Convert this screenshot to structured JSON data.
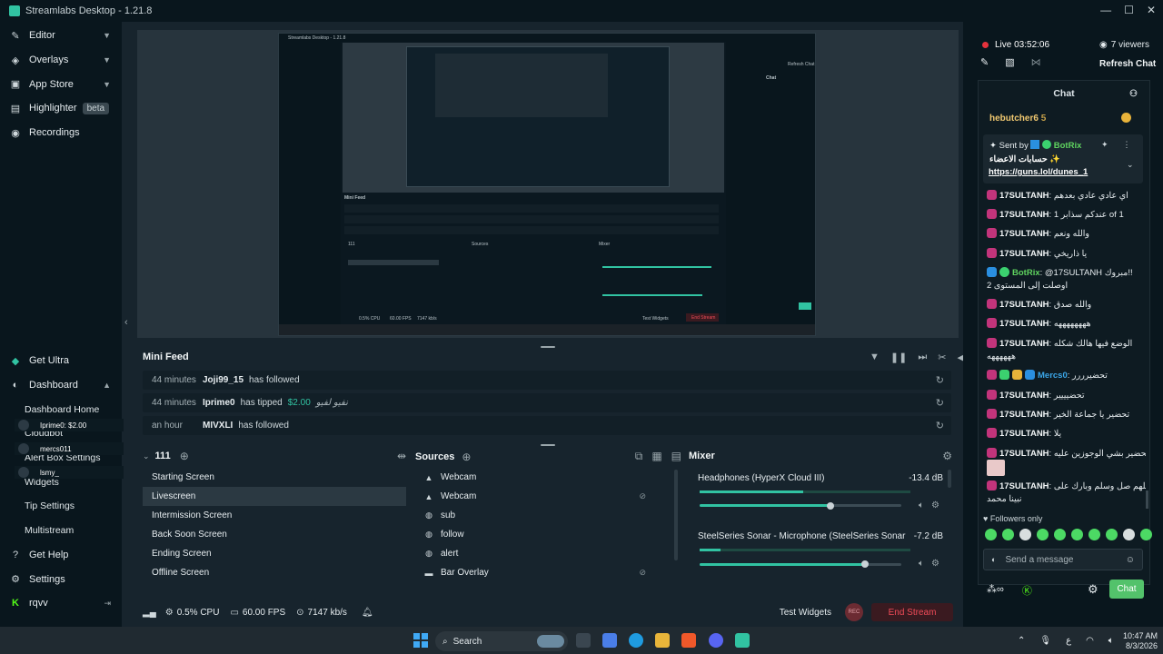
{
  "window": {
    "title": "Streamlabs Desktop - 1.21.8"
  },
  "sidebar": {
    "top": [
      {
        "label": "Editor",
        "icon": "pencil-icon"
      },
      {
        "label": "Overlays",
        "icon": "layers-icon"
      },
      {
        "label": "App Store",
        "icon": "store-icon"
      },
      {
        "label": "Highlighter",
        "icon": "film-icon",
        "badge": "beta"
      },
      {
        "label": "Recordings",
        "icon": "record-icon"
      }
    ],
    "get_ultra": "Get Ultra",
    "dashboard": "Dashboard",
    "dash_items": [
      "Dashboard Home",
      "Cloudbot",
      "Alert Box Settings",
      "Widgets",
      "Tip Settings",
      "Multistream"
    ],
    "overlays_popups": [
      "Iprime0: $2.00",
      "mercs011",
      "lsmy_"
    ],
    "get_help": "Get Help",
    "settings": "Settings",
    "user": "rqvv"
  },
  "mini_feed": {
    "title": "Mini Feed",
    "rows": [
      {
        "time": "44 minutes",
        "user": "Joji99_15",
        "msg": "has followed"
      },
      {
        "time": "44 minutes",
        "user": "Iprime0",
        "msg": "has tipped",
        "amount": "$2.00",
        "note": "نفيو لفيو"
      },
      {
        "time": "an hour",
        "user": "MIVXLI",
        "msg": "has followed"
      }
    ]
  },
  "scenes": {
    "title": "111",
    "items": [
      "Starting Screen",
      "Livescreen",
      "Intermission Screen",
      "Back Soon Screen",
      "Ending Screen",
      "Offline Screen"
    ],
    "selected": 1
  },
  "sources": {
    "title": "Sources",
    "items": [
      {
        "label": "Webcam",
        "icon": "webcam-icon"
      },
      {
        "label": "Webcam",
        "icon": "webcam-icon",
        "hidden": true
      },
      {
        "label": "sub",
        "icon": "globe-icon"
      },
      {
        "label": "follow",
        "icon": "globe-icon"
      },
      {
        "label": "alert",
        "icon": "globe-icon"
      },
      {
        "label": "Bar Overlay",
        "icon": "folder-icon",
        "hidden": true
      }
    ]
  },
  "mixer": {
    "title": "Mixer",
    "items": [
      {
        "name": "Headphones (HyperX Cloud III)",
        "db": "-13.4 dB",
        "level": 0.65
      },
      {
        "name": "SteelSeries Sonar - Microphone (SteelSeries Sonar Vi...",
        "db": "-7.2 dB",
        "level": 0.82
      }
    ]
  },
  "status": {
    "cpu": "0.5% CPU",
    "fps": "60.00 FPS",
    "bitrate": "7147 kb/s",
    "test_widgets": "Test Widgets",
    "rec": "REC",
    "end_stream": "End Stream"
  },
  "chat_panel": {
    "live": "Live 03:52:06",
    "viewers": "7 viewers",
    "refresh": "Refresh Chat",
    "tab": "Chat",
    "top_user": "hebutcher6",
    "top_count": "5",
    "pinned": {
      "sent_by": "Sent by",
      "bot": "BotRix",
      "line1": "حسابات الاعضاء ✨",
      "link": "https://guns.lol/dunes_1"
    },
    "messages": [
      {
        "user": "17SULTANH",
        "text": "اي عادي عادي بعدهم"
      },
      {
        "user": "17SULTANH",
        "text": "عندكم سذابر 1 of 1"
      },
      {
        "user": "17SULTANH",
        "text": "والله ونعم"
      },
      {
        "user": "17SULTANH",
        "text": "يا ذاريخي"
      },
      {
        "user": "BotRix",
        "text": "@17SULTANH مبروك!!"
      },
      {
        "user": "",
        "text": "اوصلت إلى المستوى 2"
      },
      {
        "user": "17SULTANH",
        "text": "والله صدق"
      },
      {
        "user": "17SULTANH",
        "text": "ههههههههه"
      },
      {
        "user": "17SULTANH",
        "text": "الوضع فيها هالك شكله"
      },
      {
        "user": "",
        "text": "ههههههه"
      },
      {
        "user": "Mercs0",
        "text": "تحضيرررر"
      },
      {
        "user": "17SULTANH",
        "text": "تحضيييير"
      },
      {
        "user": "17SULTANH",
        "text": "تحضير يا جماعة الخير"
      },
      {
        "user": "17SULTANH",
        "text": "يلا"
      },
      {
        "user": "17SULTANH",
        "text": "تحضير بشي الوجوزين عليه"
      },
      {
        "user": "17SULTANH",
        "text": "اللهم صل وسلم وبارك على"
      },
      {
        "user": "",
        "text": "نبينا محمد"
      }
    ],
    "followers_only": "Followers only",
    "placeholder": "Send a message",
    "send": "Chat"
  },
  "taskbar": {
    "search": "Search",
    "time": "10:47 AM",
    "date": "8/3/2026",
    "lang": "ع"
  },
  "nested_preview": {
    "title": "Streamlabs Desktop - 1.21.8",
    "mini_feed": "Mini Feed",
    "scenes": "111",
    "sources": "Sources",
    "mixer": "Mixer",
    "cpu": "0.5% CPU",
    "fps": "60.00 FPS",
    "bitrate": "7147 kb/s",
    "test_widgets": "Test Widgets",
    "end_stream": "End Stream",
    "chat": "Chat",
    "refresh": "Refresh Chat"
  },
  "colors": {
    "accent": "#31c3a2",
    "end_stream": "#f04b58",
    "live_dot": "#e6323c",
    "background": "#17242d",
    "sidebar": "#09161d"
  }
}
